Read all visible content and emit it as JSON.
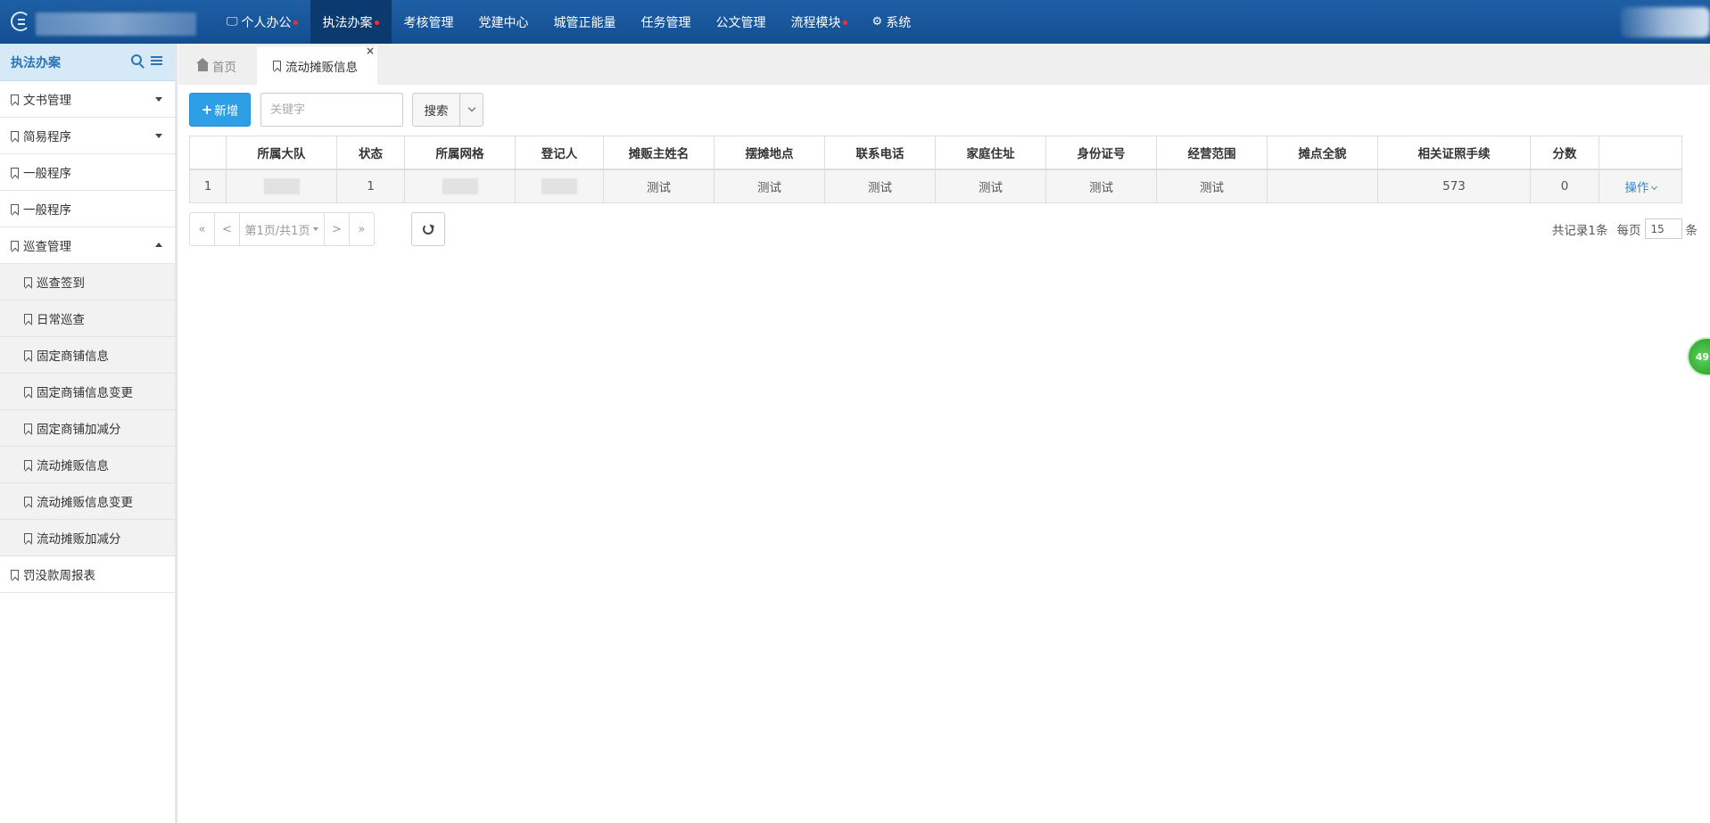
{
  "topbar": {
    "nav": [
      {
        "label": "个人办公",
        "icon": "desktop-icon",
        "dot": true
      },
      {
        "label": "执法办案",
        "icon": "",
        "dot": true,
        "active": true
      },
      {
        "label": "考核管理",
        "icon": "",
        "dot": false
      },
      {
        "label": "党建中心",
        "icon": "",
        "dot": false
      },
      {
        "label": "城管正能量",
        "icon": "",
        "dot": false
      },
      {
        "label": "任务管理",
        "icon": "",
        "dot": false
      },
      {
        "label": "公文管理",
        "icon": "",
        "dot": false
      },
      {
        "label": "流程模块",
        "icon": "",
        "dot": true
      },
      {
        "label": "系统",
        "icon": "gear-icon",
        "dot": false
      }
    ],
    "colors": {
      "bar": "#1a5699",
      "active": "#0b3a70",
      "dot": "#ff2a2a"
    }
  },
  "sidebar": {
    "title": "执法办案",
    "items": [
      {
        "label": "文书管理",
        "caret": "down"
      },
      {
        "label": "简易程序",
        "caret": "down"
      },
      {
        "label": "一般程序"
      },
      {
        "label": "一般程序"
      },
      {
        "label": "巡查管理",
        "caret": "up"
      },
      {
        "label": "巡查签到",
        "sub": true
      },
      {
        "label": "日常巡查",
        "sub": true
      },
      {
        "label": "固定商铺信息",
        "sub": true
      },
      {
        "label": "固定商铺信息变更",
        "sub": true
      },
      {
        "label": "固定商铺加减分",
        "sub": true
      },
      {
        "label": "流动摊贩信息",
        "sub": true
      },
      {
        "label": "流动摊贩信息变更",
        "sub": true
      },
      {
        "label": "流动摊贩加减分",
        "sub": true
      },
      {
        "label": "罚没款周报表"
      }
    ]
  },
  "tabs": {
    "home": "首页",
    "active": "流动摊贩信息",
    "close": "×"
  },
  "toolbar": {
    "add_label": "新增",
    "add_plus": "+",
    "search_placeholder": "关键字",
    "search_label": "搜索"
  },
  "table": {
    "columns": [
      "",
      "所属大队",
      "状态",
      "所属网格",
      "登记人",
      "摊贩主姓名",
      "摆摊地点",
      "联系电话",
      "家庭住址",
      "身份证号",
      "经营范围",
      "摊点全貌",
      "相关证照手续",
      "分数",
      ""
    ],
    "rows": [
      [
        "1",
        "",
        "1",
        "",
        "",
        "测试",
        "测试",
        "测试",
        "测试",
        "测试",
        "测试",
        "",
        "573",
        "0",
        "操作"
      ]
    ]
  },
  "pager": {
    "first": "«",
    "prev": "<",
    "page": "第1页/共1页",
    "next": ">",
    "last": "»"
  },
  "records": {
    "total": "共记录1条",
    "per_prefix": "每页",
    "per_value": "15",
    "per_suffix": "条"
  },
  "badge": "49"
}
